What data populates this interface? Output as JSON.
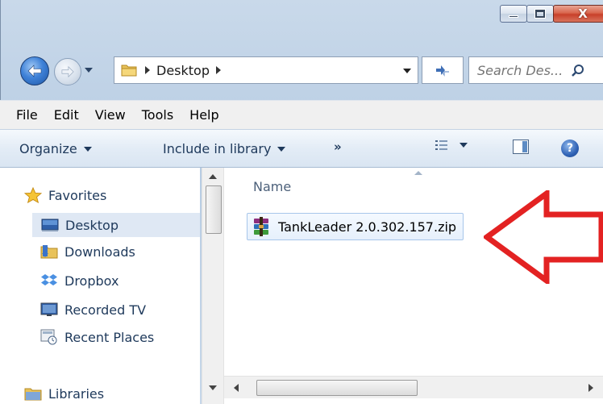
{
  "window": {
    "caption_buttons": [
      "minimize-icon",
      "maximize-icon",
      "close-icon"
    ],
    "close_glyph": "X"
  },
  "navbar": {
    "breadcrumb": [
      "Desktop"
    ],
    "search_placeholder": "Search Des..."
  },
  "menu": {
    "items": [
      "File",
      "Edit",
      "View",
      "Tools",
      "Help"
    ]
  },
  "command_bar": {
    "organize": "Organize",
    "include_in_library": "Include in library",
    "more": "»",
    "help_glyph": "?"
  },
  "nav_pane": {
    "favorites_label": "Favorites",
    "favorites_items": [
      {
        "label": "Desktop",
        "icon": "desktop-icon",
        "selected": true
      },
      {
        "label": "Downloads",
        "icon": "downloads-folder-icon"
      },
      {
        "label": "Dropbox",
        "icon": "dropbox-icon"
      },
      {
        "label": "Recorded TV",
        "icon": "recorded-tv-icon"
      },
      {
        "label": "Recent Places",
        "icon": "recent-places-icon"
      }
    ],
    "libraries_label": "Libraries"
  },
  "file_list": {
    "column_name": "Name",
    "files": [
      {
        "name": "TankLeader 2.0.302.157.zip",
        "icon": "winrar-archive-icon",
        "selected": true
      }
    ]
  },
  "colors": {
    "annotation_arrow": "#e32222",
    "selection": "#dfe8f4",
    "chrome": "#c9d9ea"
  }
}
